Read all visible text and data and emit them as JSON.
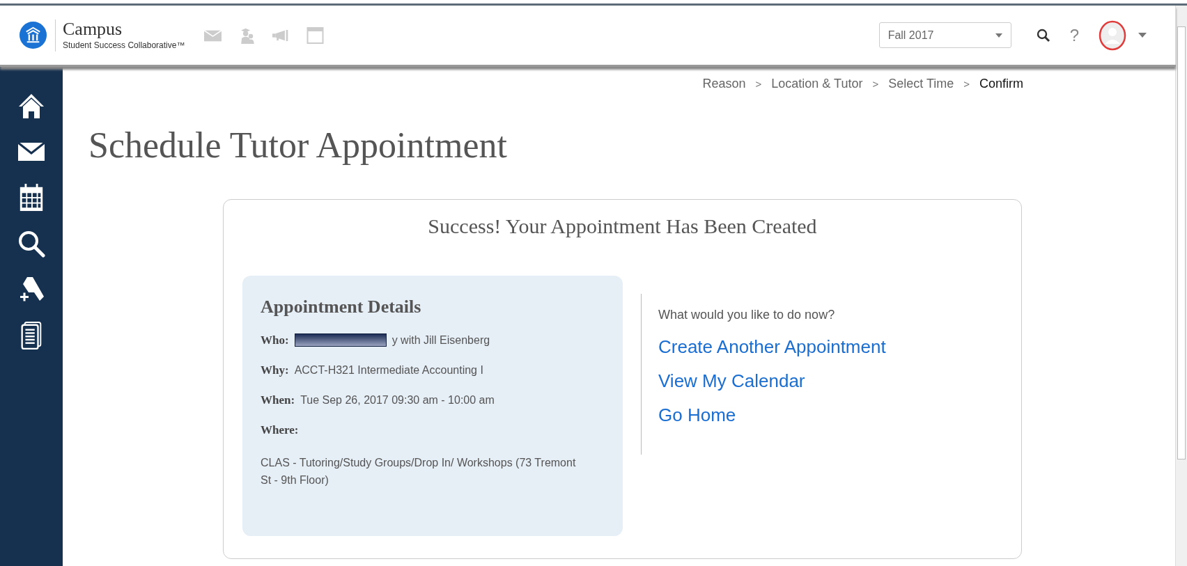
{
  "header": {
    "brand": {
      "name": "Campus",
      "subtitle": "Student Success Collaborative™"
    },
    "term_select": {
      "value": "Fall 2017"
    },
    "help": "?"
  },
  "breadcrumbs": [
    {
      "label": "Reason",
      "current": false
    },
    {
      "separator": ">",
      "label": "Location & Tutor",
      "current": false
    },
    {
      "separator": ">",
      "label": "Select Time",
      "current": false
    },
    {
      "separator": ">",
      "label": "Confirm",
      "current": true
    }
  ],
  "title": "Schedule Tutor Appointment",
  "confirmation": {
    "heading": "Success! Your Appointment Has Been Created",
    "details": {
      "heading": "Appointment Details",
      "fields": [
        {
          "label": "Who:",
          "value": "y with Jill Eisenberg",
          "kind": "redacted"
        },
        {
          "label": "Why:",
          "value": "ACCT-H321 Intermediate Accounting I",
          "kind": "inline"
        },
        {
          "label": "When:",
          "value": "Tue Sep 26, 2017 09:30 am - 10:00 am",
          "kind": "inline"
        },
        {
          "label": "Where:",
          "value": "CLAS - Tutoring/Study Groups/Drop In/ Workshops (73 Tremont St - 9th Floor)",
          "kind": "block"
        }
      ]
    },
    "next_steps": {
      "prompt": "What would you like to do now?",
      "links": [
        "Create Another Appointment",
        "View My Calendar",
        "Go Home"
      ]
    }
  }
}
